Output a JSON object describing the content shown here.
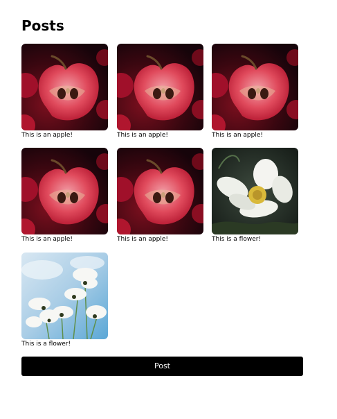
{
  "page": {
    "title": "Posts"
  },
  "posts": [
    {
      "caption": "This is an apple!",
      "image": "apple-image"
    },
    {
      "caption": "This is an apple!",
      "image": "apple-image"
    },
    {
      "caption": "This is an apple!",
      "image": "apple-image"
    },
    {
      "caption": "This is an apple!",
      "image": "apple-image"
    },
    {
      "caption": "This is an apple!",
      "image": "apple-image"
    },
    {
      "caption": "This is a flower!",
      "image": "white-flower-dark-image"
    },
    {
      "caption": "This is a flower!",
      "image": "white-flowers-sky-image"
    }
  ],
  "actions": {
    "post_label": "Post"
  },
  "colors": {
    "button_background": "#000000",
    "button_text": "#ffffff",
    "page_background": "#ffffff"
  }
}
